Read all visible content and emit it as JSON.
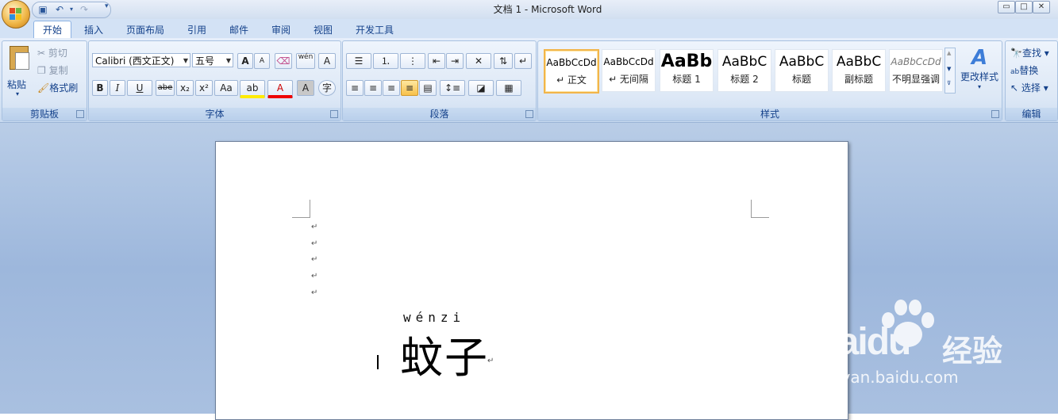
{
  "window": {
    "title": "文档 1 - Microsoft Word",
    "buttons": [
      "▭",
      "□",
      "✕"
    ]
  },
  "qat": {
    "icons": [
      "save-icon",
      "undo-icon",
      "redo-icon",
      "customize-icon"
    ]
  },
  "tabs": [
    "开始",
    "插入",
    "页面布局",
    "引用",
    "邮件",
    "审阅",
    "视图",
    "开发工具"
  ],
  "clipboard": {
    "paste": "粘贴",
    "cut": "剪切",
    "copy": "复制",
    "format_painter": "格式刷",
    "group": "剪贴板"
  },
  "font": {
    "name": "Calibri (西文正文)",
    "size": "五号",
    "group": "字体",
    "bold": "B",
    "italic": "I",
    "underline": "U",
    "strike": "abe",
    "sub": "x₂",
    "sup": "x²",
    "case": "Aa",
    "grow": "A",
    "shrink": "A",
    "clear": "A",
    "phonetic": "wén",
    "border": "A",
    "char_shade": "A",
    "enclose": "字",
    "highlight": "ab",
    "color": "A"
  },
  "paragraph": {
    "group": "段落"
  },
  "styles": {
    "group": "样式",
    "change": "更改样式",
    "tiles": [
      {
        "preview": "AaBbCcDd",
        "name": "↵ 正文"
      },
      {
        "preview": "AaBbCcDd",
        "name": "↵ 无间隔"
      },
      {
        "preview": "AaBb",
        "name": "标题 1"
      },
      {
        "preview": "AaBbC",
        "name": "标题 2"
      },
      {
        "preview": "AaBbC",
        "name": "标题"
      },
      {
        "preview": "AaBbC",
        "name": "副标题"
      },
      {
        "preview": "AaBbCcDd",
        "name": "不明显强调"
      }
    ]
  },
  "editing": {
    "group": "编辑",
    "find": "查找",
    "replace": "替换",
    "select": "选择"
  },
  "document": {
    "pinyin": "wénzi",
    "text": "蚊子",
    "para_mark": "↵"
  },
  "watermark": {
    "brand": "Baidu",
    "label": "经验",
    "url": "jingyan.baidu.com"
  },
  "colors": {
    "ribbon": "#dbe6f5",
    "doc_bg": "#a9c0e0",
    "accent": "#15428b"
  }
}
